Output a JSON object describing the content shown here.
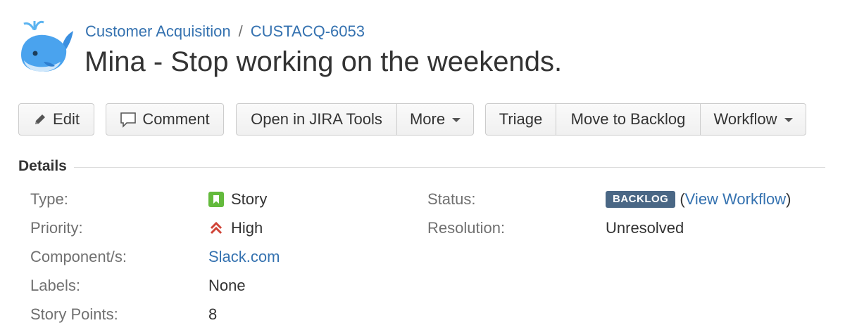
{
  "header": {
    "project": "Customer Acquisition",
    "separator": "/",
    "issue_key": "CUSTACQ-6053",
    "title": "Mina - Stop working on the weekends."
  },
  "toolbar": {
    "edit": "Edit",
    "comment": "Comment",
    "open_in_jira_tools": "Open in JIRA Tools",
    "more": "More",
    "triage": "Triage",
    "move_to_backlog": "Move to Backlog",
    "workflow": "Workflow"
  },
  "details": {
    "heading": "Details",
    "type": {
      "label": "Type:",
      "value": "Story",
      "icon": "story-icon",
      "color": "#63ba3c"
    },
    "priority": {
      "label": "Priority:",
      "value": "High",
      "icon": "priority-high-icon",
      "color": "#d04437"
    },
    "components": {
      "label": "Component/s:",
      "value": "Slack.com"
    },
    "labels": {
      "label": "Labels:",
      "value": "None"
    },
    "story_points": {
      "label": "Story Points:",
      "value": "8"
    },
    "status": {
      "label": "Status:",
      "badge": "BACKLOG",
      "badge_color": "#4a6785",
      "open_paren": "(",
      "link": "View Workflow",
      "close_paren": ")"
    },
    "resolution": {
      "label": "Resolution:",
      "value": "Unresolved"
    }
  },
  "colors": {
    "link": "#3572b0",
    "text": "#333333",
    "label": "#707070"
  }
}
